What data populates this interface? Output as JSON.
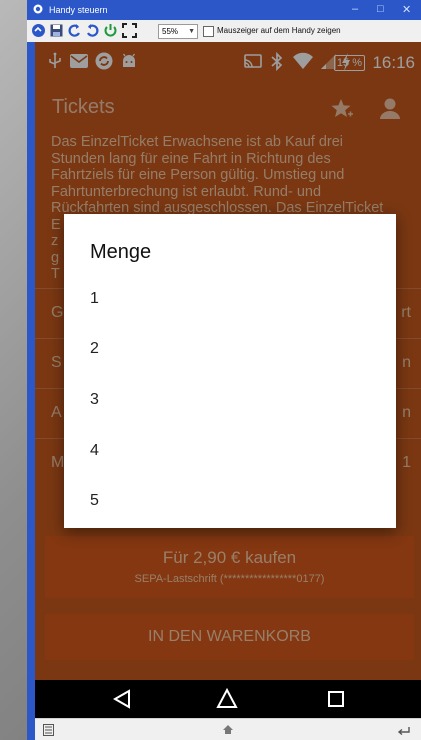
{
  "window": {
    "title": "Handy steuern",
    "zoom": "55%",
    "checkbox_label": "Mauszeiger auf dem Handy zeigen",
    "checkbox_checked": false
  },
  "statusbar": {
    "battery": "15 %",
    "time": "16:16"
  },
  "appbar": {
    "title": "Tickets"
  },
  "background": {
    "description_lines": [
      "Das EinzelTicket Erwachsene ist ab Kauf drei",
      "Stunden lang für eine Fahrt in Richtung des",
      "Fahrtziels für eine Person gültig. Umstieg und",
      "Fahrtunterbrechung ist erlaubt. Rund- und",
      "Rückfahrten sind ausgeschlossen. Das EinzelTicket",
      "E",
      "z",
      "g",
      "T"
    ],
    "rows": [
      {
        "left": "G",
        "right": "rt"
      },
      {
        "left": "S",
        "right": "n"
      },
      {
        "left": "A",
        "right": "n"
      },
      {
        "left": "M",
        "right": "1"
      }
    ],
    "buy_button": {
      "label": "Für 2,90 € kaufen",
      "subtitle": "SEPA-Lastschrift (*****************0177)"
    },
    "cart_button": {
      "label": "IN DEN WARENKORB"
    }
  },
  "dialog": {
    "title": "Menge",
    "options": [
      "1",
      "2",
      "3",
      "4",
      "5"
    ]
  },
  "colors": {
    "accent": "#c65a1e",
    "button": "#d65a1c",
    "titlebar": "#2b57c9"
  },
  "icons": {
    "statusbar": [
      "usb-icon",
      "mail-icon",
      "sync-icon",
      "android-icon",
      "cast-icon",
      "bluetooth-icon",
      "wifi-icon",
      "signal-icon",
      "charging-icon"
    ],
    "appbar": [
      "star-add-icon",
      "account-icon"
    ],
    "navbar": [
      "back-icon",
      "home-icon",
      "recents-icon"
    ]
  }
}
